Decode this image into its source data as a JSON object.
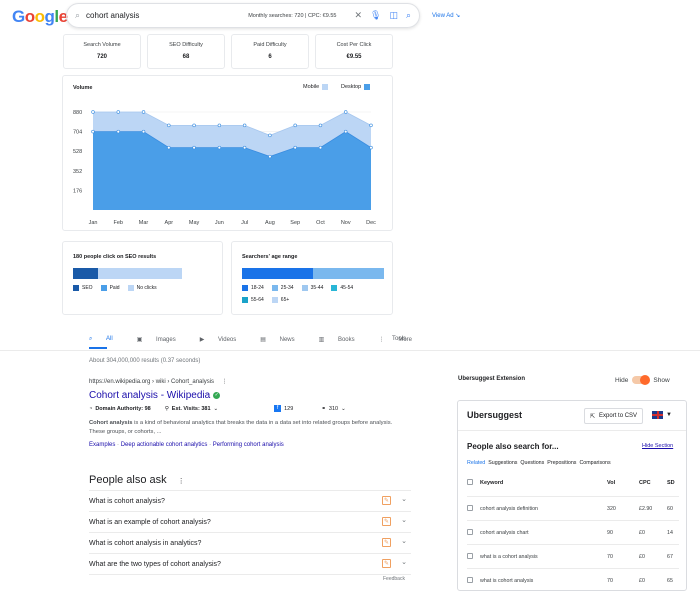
{
  "google_logo": [
    {
      "ch": "G",
      "color": "#4285F4"
    },
    {
      "ch": "o",
      "color": "#EA4335"
    },
    {
      "ch": "o",
      "color": "#FBBC05"
    },
    {
      "ch": "g",
      "color": "#4285F4"
    },
    {
      "ch": "l",
      "color": "#34A853"
    },
    {
      "ch": "e",
      "color": "#EA4335"
    }
  ],
  "search": {
    "query": "cohort analysis",
    "metrics": "Monthly searches: 720 | CPC: €9.55",
    "view_ad": "View Ad ↘"
  },
  "stats": [
    {
      "label": "Search Volume",
      "value": "720"
    },
    {
      "label": "SEO Difficulty",
      "value": "68"
    },
    {
      "label": "Paid Difficulty",
      "value": "6"
    },
    {
      "label": "Cost Per Click",
      "value": "€9.55"
    }
  ],
  "volume_legend": {
    "mobile": "Mobile",
    "desktop": "Desktop"
  },
  "chart_data": {
    "type": "area",
    "title": "Volume",
    "categories": [
      "Jan",
      "Feb",
      "Mar",
      "Apr",
      "May",
      "Jun",
      "Jul",
      "Aug",
      "Sep",
      "Oct",
      "Nov",
      "Dec"
    ],
    "y_ticks": [
      176,
      352,
      528,
      704,
      880
    ],
    "ylim": [
      0,
      880
    ],
    "series": [
      {
        "name": "Desktop",
        "color": "#4a9ee8",
        "values": [
          704,
          704,
          704,
          560,
          560,
          560,
          560,
          480,
          560,
          560,
          704,
          560
        ]
      },
      {
        "name": "Mobile",
        "color": "#bcd6f5",
        "values": [
          880,
          880,
          880,
          760,
          760,
          760,
          760,
          670,
          760,
          760,
          880,
          760
        ]
      }
    ],
    "grid": true,
    "legend": "top-right"
  },
  "seo_clicks": {
    "title": "180 people click on SEO results",
    "segments": [
      {
        "name": "SEO",
        "share": 0.23,
        "color": "#1a5aa8"
      },
      {
        "name": "Paid",
        "share": 0,
        "color": "#4a9ee8"
      },
      {
        "name": "No clicks",
        "share": 0.77,
        "color": "#bcd6f5"
      }
    ]
  },
  "age_range": {
    "title": "Searchers' age range",
    "segments": [
      {
        "name": "18-24",
        "share": 0.5,
        "color": "#1a73e8"
      },
      {
        "name": "25-34",
        "share": 0.5,
        "color": "#7ab8ee"
      },
      {
        "name": "35-44",
        "share": 0,
        "color": "#9fc8f0"
      },
      {
        "name": "45-54",
        "share": 0,
        "color": "#29b6d6"
      },
      {
        "name": "55-64",
        "share": 0,
        "color": "#1aa3c9"
      },
      {
        "name": "65+",
        "share": 0,
        "color": "#bcd6f5"
      }
    ]
  },
  "tabs": [
    {
      "label": "All",
      "icon": "search-icon",
      "glyph": "⌕",
      "active": true
    },
    {
      "label": "Images",
      "icon": "image-icon",
      "glyph": "▣"
    },
    {
      "label": "Videos",
      "icon": "video-icon",
      "glyph": "▶"
    },
    {
      "label": "News",
      "icon": "news-icon",
      "glyph": "▤"
    },
    {
      "label": "Books",
      "icon": "book-icon",
      "glyph": "▥"
    },
    {
      "label": "More",
      "icon": "more-icon",
      "glyph": "⋮"
    }
  ],
  "tools": "Tools",
  "result_stats": "About 304,000,000 results (0.37 seconds)",
  "result": {
    "url": "https://en.wikipedia.org › wiki › Cohort_analysis",
    "title": "Cohort analysis - Wikipedia",
    "domain_authority": "Domain Authority: 98",
    "est_visits": "Est. Visits: 381",
    "fb_shares": "129",
    "link_shares": "310",
    "snippet_bold": "Cohort analysis",
    "snippet_rest": " is a kind of behavioral analytics that breaks the data in a data set into related groups before analysis. These groups, or cohorts, ...",
    "sublinks": [
      "Examples",
      "Deep actionable cohort analytics",
      "Performing cohort analysis"
    ]
  },
  "people_also_ask": {
    "title": "People also ask",
    "questions": [
      "What is cohort analysis?",
      "What is an example of cohort analysis?",
      "What is cohort analysis in analytics?",
      "What are the two types of cohort analysis?"
    ],
    "feedback": "Feedback"
  },
  "extension": {
    "label": "Ubersuggest Extension",
    "hide": "Hide",
    "show": "Show",
    "brand": "Ubersuggest",
    "export": "Export to CSV",
    "pasf_title": "People also search for...",
    "hide_section": "Hide Section",
    "tabs": [
      "Related",
      "Suggestions",
      "Questions",
      "Prepositions",
      "Comparisons"
    ],
    "columns": {
      "keyword": "Keyword",
      "vol": "Vol",
      "cpc": "CPC",
      "sd": "SD"
    },
    "rows": [
      {
        "keyword": "cohort analysis definition",
        "vol": "320",
        "cpc": "£2.90",
        "sd": "60"
      },
      {
        "keyword": "cohort analysis chart",
        "vol": "90",
        "cpc": "£0",
        "sd": "14"
      },
      {
        "keyword": "what is a cohort analysis",
        "vol": "70",
        "cpc": "£0",
        "sd": "67"
      },
      {
        "keyword": "what is cohort analysis",
        "vol": "70",
        "cpc": "£0",
        "sd": "65"
      }
    ]
  }
}
